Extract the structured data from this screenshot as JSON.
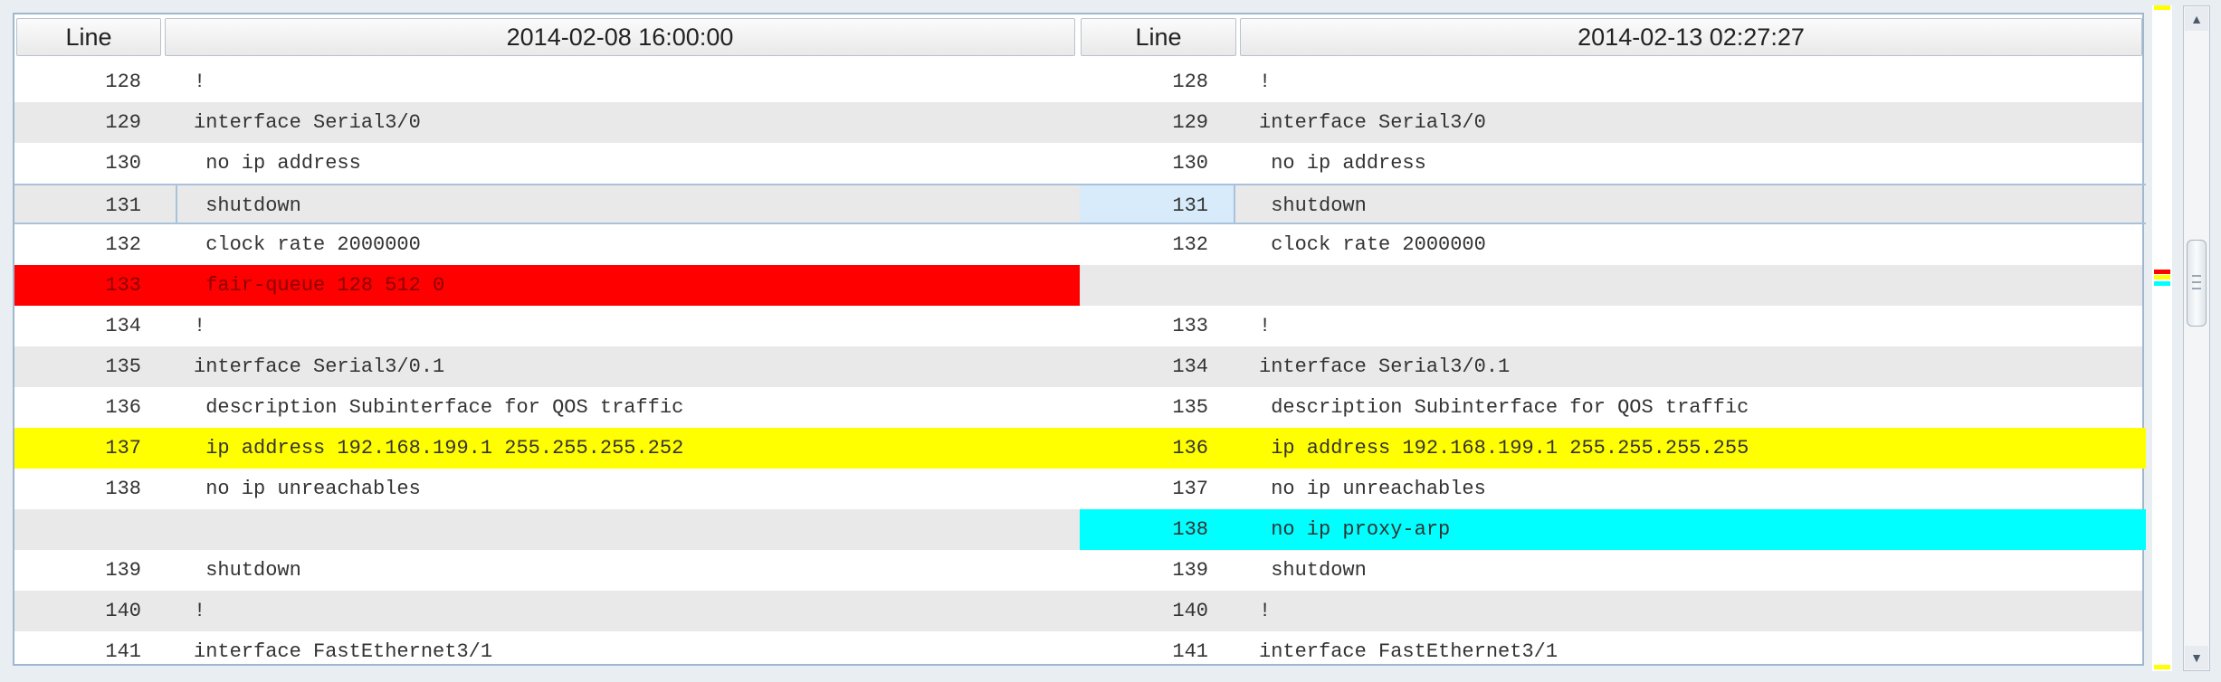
{
  "header": {
    "left_line_label": "Line",
    "left_title": "2014-02-08 16:00:00",
    "right_line_label": "Line",
    "right_title": "2014-02-13 02:27:27"
  },
  "rows": [
    {
      "left_num": "128",
      "left_code": "!",
      "right_num": "128",
      "right_code": "!",
      "shade": false,
      "current": false,
      "left_hl": "",
      "right_hl": ""
    },
    {
      "left_num": "129",
      "left_code": "interface Serial3/0",
      "right_num": "129",
      "right_code": "interface Serial3/0",
      "shade": true,
      "current": false,
      "left_hl": "",
      "right_hl": ""
    },
    {
      "left_num": "130",
      "left_code": " no ip address",
      "right_num": "130",
      "right_code": " no ip address",
      "shade": false,
      "current": false,
      "left_hl": "",
      "right_hl": ""
    },
    {
      "left_num": "131",
      "left_code": " shutdown",
      "right_num": "131",
      "right_code": " shutdown",
      "shade": true,
      "current": true,
      "left_hl": "",
      "right_hl": ""
    },
    {
      "left_num": "132",
      "left_code": " clock rate 2000000",
      "right_num": "132",
      "right_code": " clock rate 2000000",
      "shade": false,
      "current": false,
      "left_hl": "",
      "right_hl": ""
    },
    {
      "left_num": "133",
      "left_code": " fair-queue 128 512 0",
      "right_num": "",
      "right_code": "",
      "shade": true,
      "current": false,
      "left_hl": "red",
      "right_hl": ""
    },
    {
      "left_num": "134",
      "left_code": "!",
      "right_num": "133",
      "right_code": "!",
      "shade": false,
      "current": false,
      "left_hl": "",
      "right_hl": ""
    },
    {
      "left_num": "135",
      "left_code": "interface Serial3/0.1",
      "right_num": "134",
      "right_code": "interface Serial3/0.1",
      "shade": true,
      "current": false,
      "left_hl": "",
      "right_hl": ""
    },
    {
      "left_num": "136",
      "left_code": " description Subinterface for QOS traffic",
      "right_num": "135",
      "right_code": " description Subinterface for QOS traffic",
      "shade": false,
      "current": false,
      "left_hl": "",
      "right_hl": ""
    },
    {
      "left_num": "137",
      "left_code": " ip address 192.168.199.1 255.255.255.252",
      "right_num": "136",
      "right_code": " ip address 192.168.199.1 255.255.255.255",
      "shade": true,
      "current": false,
      "left_hl": "yellow",
      "right_hl": "yellow"
    },
    {
      "left_num": "138",
      "left_code": " no ip unreachables",
      "right_num": "137",
      "right_code": " no ip unreachables",
      "shade": false,
      "current": false,
      "left_hl": "",
      "right_hl": ""
    },
    {
      "left_num": "",
      "left_code": "",
      "right_num": "138",
      "right_code": " no ip proxy-arp",
      "shade": true,
      "current": false,
      "left_hl": "",
      "right_hl": "cyan"
    },
    {
      "left_num": "139",
      "left_code": " shutdown",
      "right_num": "139",
      "right_code": " shutdown",
      "shade": false,
      "current": false,
      "left_hl": "",
      "right_hl": ""
    },
    {
      "left_num": "140",
      "left_code": "!",
      "right_num": "140",
      "right_code": "!",
      "shade": true,
      "current": false,
      "left_hl": "",
      "right_hl": ""
    },
    {
      "left_num": "141",
      "left_code": "interface FastEthernet3/1",
      "right_num": "141",
      "right_code": "interface FastEthernet3/1",
      "shade": false,
      "current": false,
      "left_hl": "",
      "right_hl": ""
    }
  ],
  "overview_marks": [
    {
      "color": "#ffff00",
      "pos": 0.0
    },
    {
      "color": "#ff0000",
      "pos": 0.397
    },
    {
      "color": "#ffff00",
      "pos": 0.405
    },
    {
      "color": "#00ffff",
      "pos": 0.414
    },
    {
      "color": "#ffff00",
      "pos": 0.99
    }
  ],
  "scrollbar": {
    "up_icon": "▲",
    "down_icon": "▼",
    "position": 0.43
  },
  "colors": {
    "deleted": "#ff0000",
    "changed": "#ffff00",
    "added": "#00ffff",
    "current_border": "#a9c2dc"
  }
}
